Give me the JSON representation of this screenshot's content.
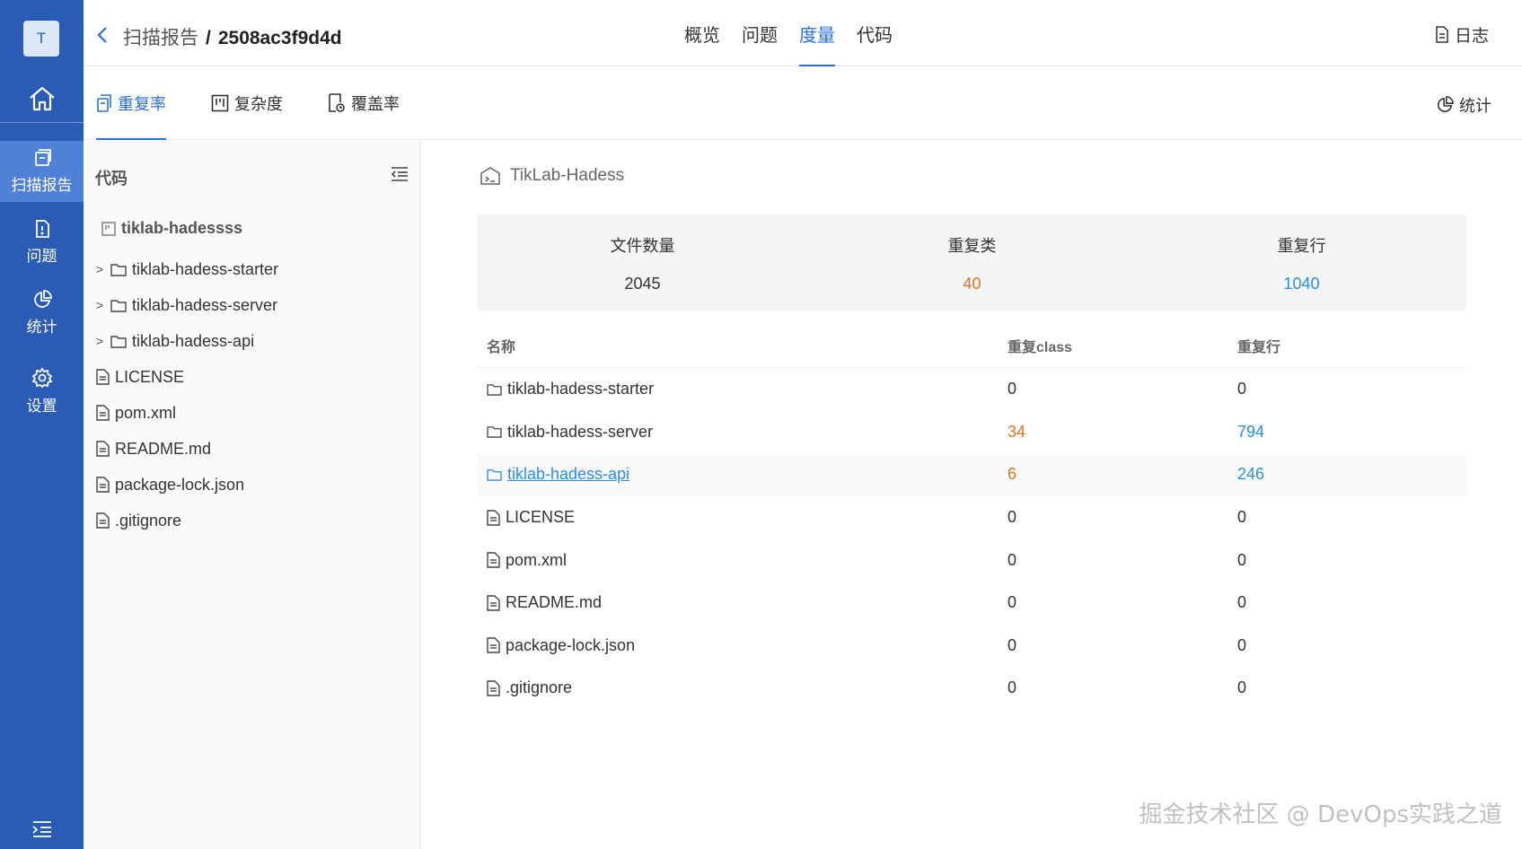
{
  "rail": {
    "avatar": "T",
    "items": [
      {
        "label": "扫描报告",
        "icon": "scan-report-icon",
        "active": true
      },
      {
        "label": "问题",
        "icon": "issue-icon",
        "active": false
      },
      {
        "label": "统计",
        "icon": "stats-icon",
        "active": false
      },
      {
        "label": "设置",
        "icon": "settings-icon",
        "active": false
      }
    ]
  },
  "header": {
    "breadcrumb": "扫描报告",
    "separator": "/",
    "scan_id": "2508ac3f9d4d",
    "tabs": [
      "概览",
      "问题",
      "度量",
      "代码"
    ],
    "active_tab": "度量",
    "log_label": "日志"
  },
  "subtabs": {
    "items": [
      "重复率",
      "复杂度",
      "覆盖率"
    ],
    "active": "重复率",
    "stat_label": "统计"
  },
  "tree": {
    "title": "代码",
    "root": "tiklab-hadessss",
    "items": [
      {
        "name": "tiklab-hadess-starter",
        "type": "folder"
      },
      {
        "name": "tiklab-hadess-server",
        "type": "folder"
      },
      {
        "name": "tiklab-hadess-api",
        "type": "folder"
      },
      {
        "name": "LICENSE",
        "type": "file"
      },
      {
        "name": "pom.xml",
        "type": "file"
      },
      {
        "name": "README.md",
        "type": "file"
      },
      {
        "name": "package-lock.json",
        "type": "file"
      },
      {
        "name": ".gitignore",
        "type": "file"
      }
    ]
  },
  "main": {
    "project": "TikLab-Hadess",
    "stats": [
      {
        "label": "文件数量",
        "value": "2045",
        "color": "#333333"
      },
      {
        "label": "重复类",
        "value": "40",
        "color": "#e0731f"
      },
      {
        "label": "重复行",
        "value": "1040",
        "color": "#2b8ee0"
      }
    ],
    "table": {
      "headers": [
        "名称",
        "重复class",
        "重复行"
      ],
      "rows": [
        {
          "name": "tiklab-hadess-starter",
          "type": "folder",
          "classes": "0",
          "lines": "0"
        },
        {
          "name": "tiklab-hadess-server",
          "type": "folder",
          "classes": "34",
          "lines": "794"
        },
        {
          "name": "tiklab-hadess-api",
          "type": "folder",
          "classes": "6",
          "lines": "246"
        },
        {
          "name": "LICENSE",
          "type": "file",
          "classes": "0",
          "lines": "0"
        },
        {
          "name": "pom.xml",
          "type": "file",
          "classes": "0",
          "lines": "0"
        },
        {
          "name": "README.md",
          "type": "file",
          "classes": "0",
          "lines": "0"
        },
        {
          "name": "package-lock.json",
          "type": "file",
          "classes": "0",
          "lines": "0"
        },
        {
          "name": ".gitignore",
          "type": "file",
          "classes": "0",
          "lines": "0"
        }
      ]
    }
  },
  "watermark": "掘金技术社区 @ DevOps实践之道",
  "colors": {
    "rail": "#2b5cb5",
    "rail_active": "#4f82d6",
    "accent": "#2b6fd6",
    "orange": "#e0731f",
    "link": "#2b8ee0"
  }
}
